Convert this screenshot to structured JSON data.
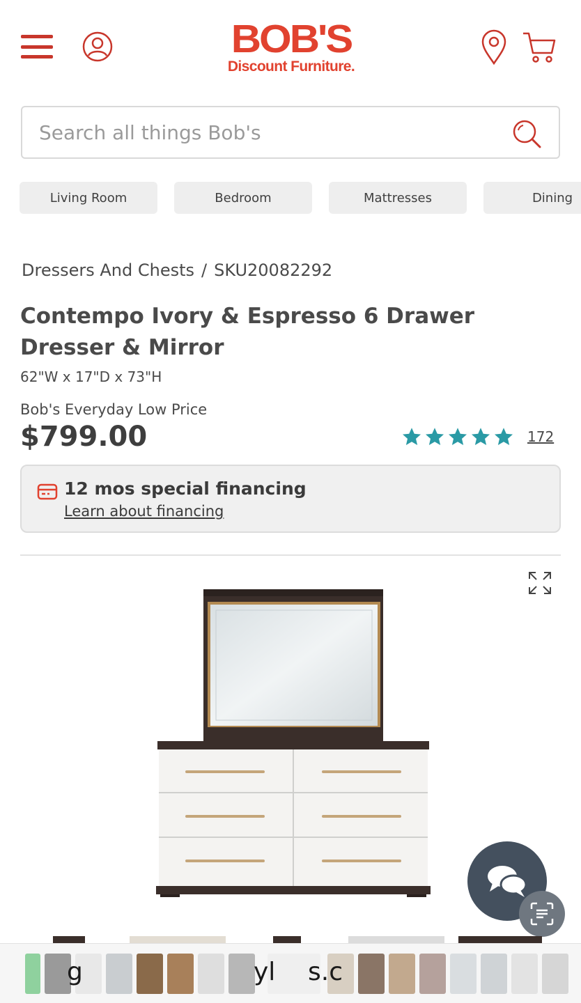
{
  "header": {
    "logo_main": "BOB'S",
    "logo_sub": "Discount Furniture.",
    "brand_color": "#e1422f"
  },
  "search": {
    "placeholder": "Search all things Bob's"
  },
  "categories": [
    "Living Room",
    "Bedroom",
    "Mattresses",
    "Dining"
  ],
  "breadcrumb": {
    "category": "Dressers And Chests",
    "separator": "/",
    "sku": "SKU20082292"
  },
  "product": {
    "title": "Contempo Ivory & Espresso 6 Drawer Dresser & Mirror",
    "dimensions": "62\"W x 17\"D x 73\"H",
    "price_label": "Bob's Everyday Low Price",
    "price": "$799.00",
    "rating": 5,
    "rating_max": 5,
    "review_count": "172",
    "star_color": "#2a9aa5"
  },
  "financing": {
    "title": "12 mos special financing",
    "link": "Learn about financing"
  },
  "tray": {
    "text_fragments": [
      "g",
      "yl",
      "s.c"
    ]
  }
}
